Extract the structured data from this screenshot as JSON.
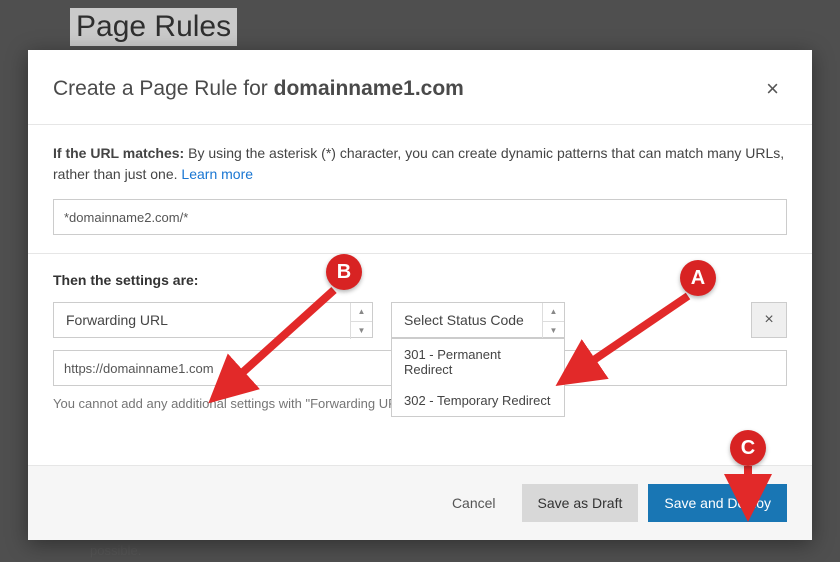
{
  "background": {
    "page_title": "Page Rules",
    "snippet": "possible."
  },
  "modal": {
    "title_prefix": "Create a Page Rule for ",
    "domain": "domainname1.com",
    "close_label": "×"
  },
  "match_section": {
    "label_bold": "If the URL matches:",
    "label_rest": " By using the asterisk (*) character, you can create dynamic patterns that can match many URLs, rather than just one. ",
    "learn_more": "Learn more",
    "url_value": "*domainname2.com/*"
  },
  "settings_section": {
    "label": "Then the settings are:",
    "setting_select": "Forwarding URL",
    "status_select": "Select Status Code",
    "dropdown_options": [
      "301 - Permanent Redirect",
      "302 - Temporary Redirect"
    ],
    "dest_value": "https://domainname1.com",
    "remove_label": "×",
    "note": "You cannot add any additional settings with \"Forwarding URL\" selected."
  },
  "footer": {
    "cancel": "Cancel",
    "draft": "Save as Draft",
    "deploy": "Save and Deploy"
  },
  "annotations": {
    "a": "A",
    "b": "B",
    "c": "C"
  }
}
